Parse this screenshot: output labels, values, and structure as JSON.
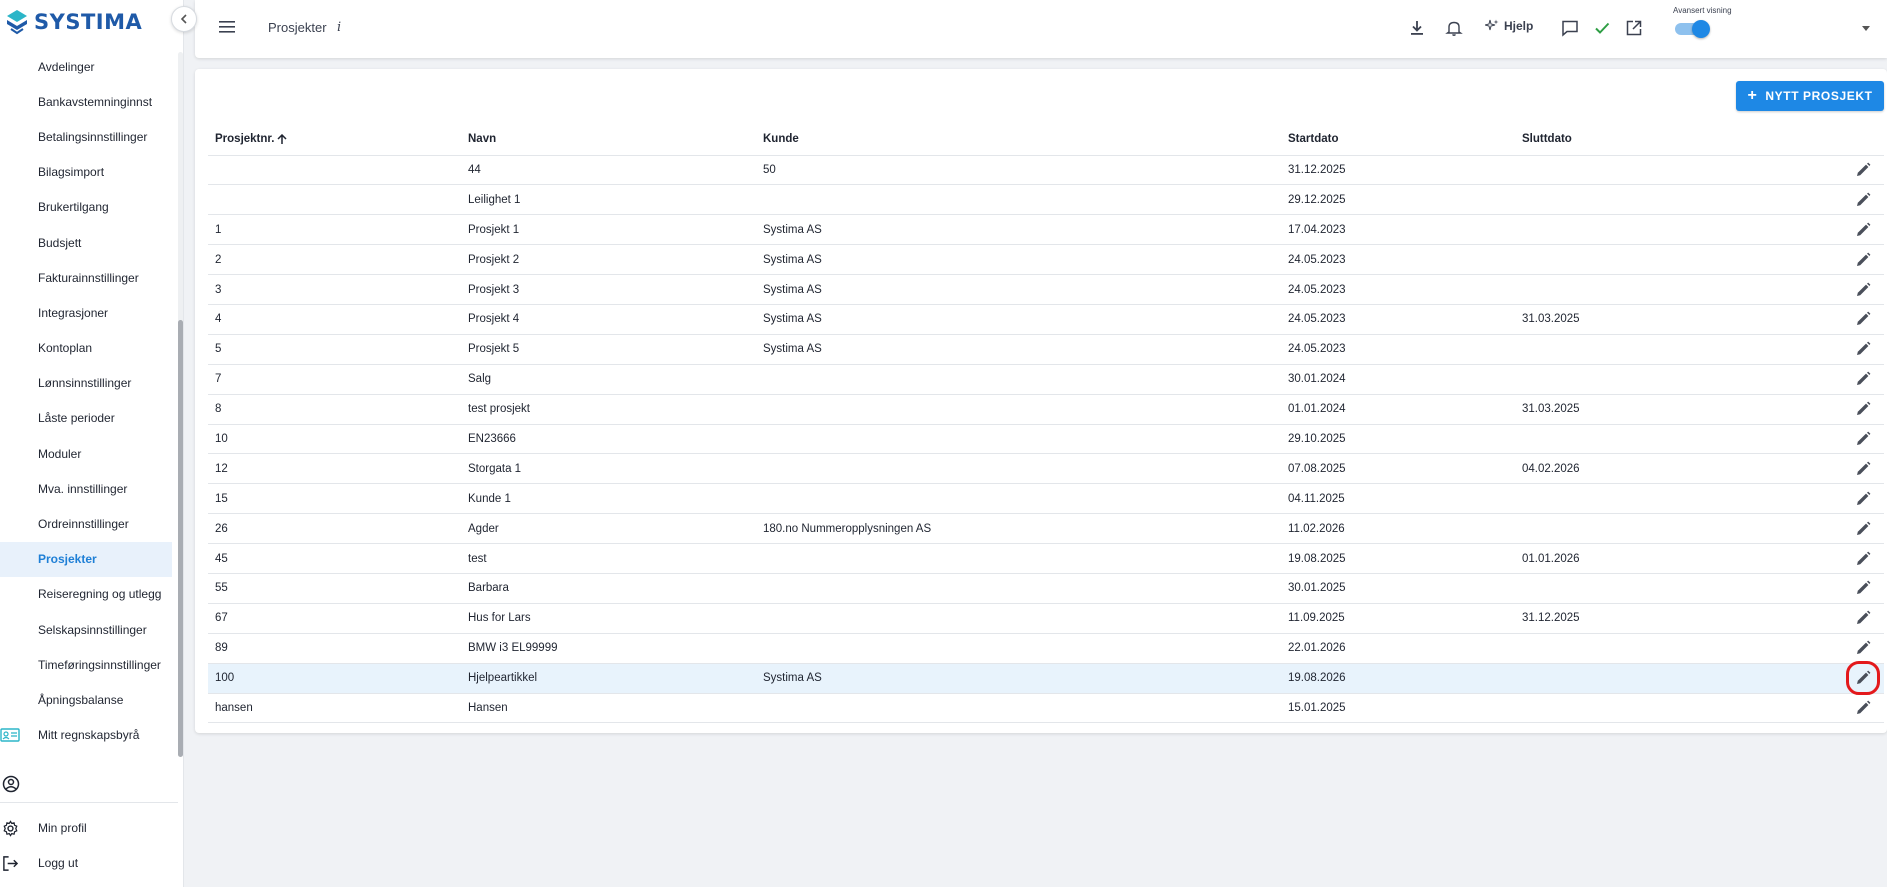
{
  "brand": {
    "name": "SYSTIMA",
    "color": "#1f5aa8",
    "accent": "#2bb5c8"
  },
  "sidebar": {
    "items": [
      {
        "label": "Avdelinger"
      },
      {
        "label": "Bankavstemninginnst"
      },
      {
        "label": "Betalingsinnstillinger"
      },
      {
        "label": "Bilagsimport"
      },
      {
        "label": "Brukertilgang"
      },
      {
        "label": "Budsjett"
      },
      {
        "label": "Fakturainnstillinger"
      },
      {
        "label": "Integrasjoner"
      },
      {
        "label": "Kontoplan"
      },
      {
        "label": "Lønnsinnstillinger"
      },
      {
        "label": "Låste perioder"
      },
      {
        "label": "Moduler"
      },
      {
        "label": "Mva. innstillinger"
      },
      {
        "label": "Ordreinnstillinger"
      },
      {
        "label": "Prosjekter",
        "active": true
      },
      {
        "label": "Reiseregning og utlegg"
      },
      {
        "label": "Selskapsinnstillinger"
      },
      {
        "label": "Timeføringsinnstillinger"
      },
      {
        "label": "Åpningsbalanse"
      },
      {
        "label": "Mitt regnskapsbyrå",
        "icon": "id-card-icon"
      }
    ],
    "bottom": [
      {
        "label": "Min profil",
        "icon": "gear-icon"
      },
      {
        "label": "Logg ut",
        "icon": "logout-icon"
      }
    ]
  },
  "header": {
    "title": "Prosjekter",
    "info_icon": "i",
    "help_label": "Hjelp",
    "toggle_label": "Avansert visning",
    "toggle_on": true
  },
  "toolbar": {
    "new_project_label": "NYTT PROSJEKT"
  },
  "table": {
    "columns": [
      "Prosjektnr.",
      "Navn",
      "Kunde",
      "Startdato",
      "Sluttdato"
    ],
    "rows": [
      [
        "",
        "44",
        "50",
        "31.12.2025",
        ""
      ],
      [
        "",
        "Leilighet 1",
        "",
        "29.12.2025",
        ""
      ],
      [
        "1",
        "Prosjekt 1",
        "Systima AS",
        "17.04.2023",
        ""
      ],
      [
        "2",
        "Prosjekt 2",
        "Systima AS",
        "24.05.2023",
        ""
      ],
      [
        "3",
        "Prosjekt 3",
        "Systima AS",
        "24.05.2023",
        ""
      ],
      [
        "4",
        "Prosjekt 4",
        "Systima AS",
        "24.05.2023",
        "31.03.2025"
      ],
      [
        "5",
        "Prosjekt 5",
        "Systima AS",
        "24.05.2023",
        ""
      ],
      [
        "7",
        "Salg",
        "",
        "30.01.2024",
        ""
      ],
      [
        "8",
        "test prosjekt",
        "",
        "01.01.2024",
        "31.03.2025"
      ],
      [
        "10",
        "EN23666",
        "",
        "29.10.2025",
        ""
      ],
      [
        "12",
        "Storgata 1",
        "",
        "07.08.2025",
        "04.02.2026"
      ],
      [
        "15",
        "Kunde 1",
        "",
        "04.11.2025",
        ""
      ],
      [
        "26",
        "Agder",
        "180.no Nummeropplysningen AS",
        "11.02.2026",
        ""
      ],
      [
        "45",
        "test",
        "",
        "19.08.2025",
        "01.01.2026"
      ],
      [
        "55",
        "Barbara",
        "",
        "30.01.2025",
        ""
      ],
      [
        "67",
        "Hus for Lars",
        "",
        "11.09.2025",
        "31.12.2025"
      ],
      [
        "89",
        "BMW i3 EL99999",
        "",
        "22.01.2026",
        ""
      ],
      [
        "100",
        "Hjelpeartikkel",
        "Systima AS",
        "19.08.2026",
        ""
      ],
      [
        "hansen",
        "Hansen",
        "",
        "15.01.2025",
        ""
      ]
    ],
    "highlighted_row": 17
  },
  "colors": {
    "primary": "#1e88e5",
    "active_bg": "#e8f1fb",
    "highlight_outline": "#e3191c",
    "check": "#2e9e44"
  }
}
